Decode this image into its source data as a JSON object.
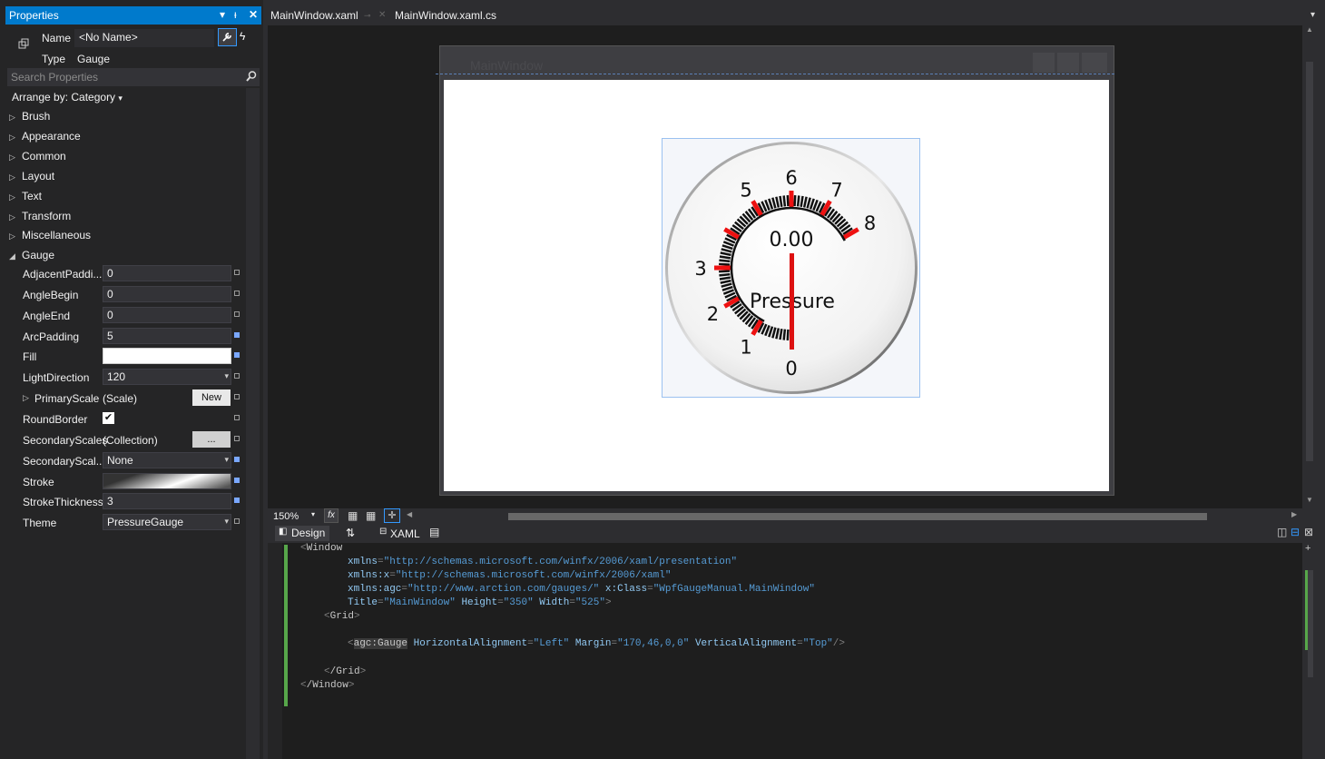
{
  "properties": {
    "title": "Properties",
    "name_label": "Name",
    "name_value": "<No Name>",
    "type_label": "Type",
    "type_value": "Gauge",
    "search_placeholder": "Search Properties",
    "arrange_by": "Arrange by: Category",
    "categories": [
      "Brush",
      "Appearance",
      "Common",
      "Layout",
      "Text",
      "Transform",
      "Miscellaneous"
    ],
    "gauge_category": "Gauge",
    "rows": [
      {
        "label": "AdjacentPaddi...",
        "value": "0"
      },
      {
        "label": "AngleBegin",
        "value": "0"
      },
      {
        "label": "AngleEnd",
        "value": "0"
      },
      {
        "label": "ArcPadding",
        "value": "5"
      },
      {
        "label": "Fill",
        "value": ""
      },
      {
        "label": "LightDirection",
        "value": "120"
      },
      {
        "label": "PrimaryScale",
        "value": "(Scale)",
        "button": "New"
      },
      {
        "label": "RoundBorder",
        "value": ""
      },
      {
        "label": "SecondaryScales",
        "value": "(Collection)",
        "button": "..."
      },
      {
        "label": "SecondaryScal...",
        "value": "None"
      },
      {
        "label": "Stroke",
        "value": ""
      },
      {
        "label": "StrokeThickness",
        "value": "3"
      },
      {
        "label": "Theme",
        "value": "PressureGauge"
      }
    ]
  },
  "tabs": [
    {
      "label": "MainWindow.xaml"
    },
    {
      "label": "MainWindow.xaml.cs"
    }
  ],
  "designer": {
    "window_title": "MainWindow",
    "gauge": {
      "value_text": "0.00",
      "label": "Pressure",
      "scale_labels": [
        "0",
        "1",
        "2",
        "3",
        "5",
        "6",
        "7",
        "8"
      ],
      "needle_color": "#dd1111",
      "major_tick_color": "#ee1111"
    }
  },
  "toolbar": {
    "zoom": "150%",
    "fx": "fx",
    "design_tab": "Design",
    "swap": "⇅",
    "xaml_tab": "XAML"
  },
  "code": {
    "l1_tag": "Window",
    "l2_attr": "xmlns",
    "l2_val": "\"http://schemas.microsoft.com/winfx/2006/xaml/presentation\"",
    "l3_attr": "xmlns:x",
    "l3_val": "\"http://schemas.microsoft.com/winfx/2006/xaml\"",
    "l4_attr": "xmlns:agc",
    "l4_val": "\"http://www.arction.com/gauges/\"",
    "l4_attr2": "x:Class",
    "l4_val2": "\"WpfGaugeManual.MainWindow\"",
    "l5_attr": "Title",
    "l5_val": "\"MainWindow\"",
    "l5_attr2": "Height",
    "l5_val2": "\"350\"",
    "l5_attr3": "Width",
    "l5_val3": "\"525\"",
    "l6_tag": "Grid",
    "l7_tag": "agc:Gauge",
    "l7_attr": "HorizontalAlignment",
    "l7_val": "\"Left\"",
    "l7_attr2": "Margin",
    "l7_val2": "\"170,46,0,0\"",
    "l7_attr3": "VerticalAlignment",
    "l7_val3": "\"Top\"",
    "l8_tag": "/Grid",
    "l9_tag": "/Window"
  }
}
